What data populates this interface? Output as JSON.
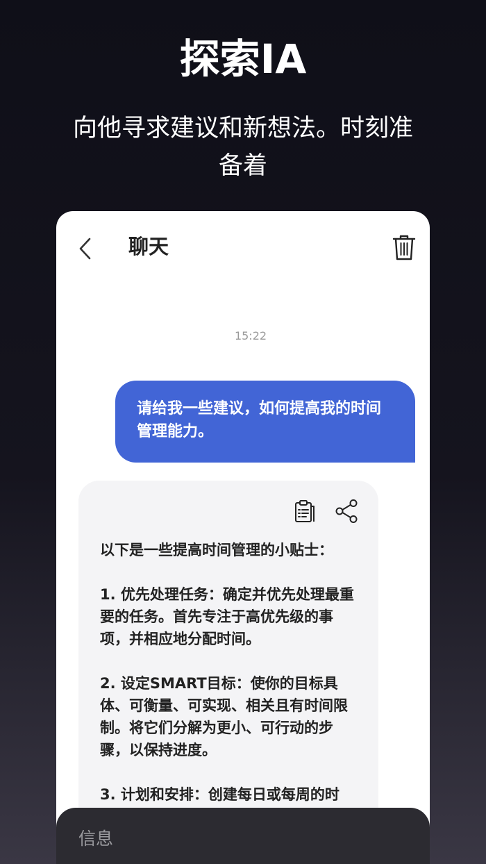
{
  "promo": {
    "headline": "探索IA",
    "subline": "向他寻求建议和新想法。时刻准备着"
  },
  "chat": {
    "title": "聊天",
    "timestamp": "15:22",
    "user_message": "请给我一些建议，如何提高我的时间管理能力。",
    "ai_message": "以下是一些提高时间管理的小贴士：\n\n1. 优先处理任务：确定并优先处理最重要的任务。首先专注于高优先级的事项，并相应地分配时间。\n\n2. 设定SMART目标：使你的目标具体、可衡量、可实现、相关且有时间限制。将它们分解为更小、可行动的步骤，以保持进度。\n\n3. 计划和安排：创建每日或每周的时",
    "input_placeholder": "信息"
  },
  "icons": {
    "back": "chevron-left-icon",
    "delete": "trash-icon",
    "copy": "clipboard-icon",
    "share": "share-icon"
  },
  "colors": {
    "background": "#0f0f18",
    "card": "#ffffff",
    "user_bubble": "#4265d6",
    "ai_bubble": "#f4f4f6",
    "input_bar": "#2c2b31"
  }
}
